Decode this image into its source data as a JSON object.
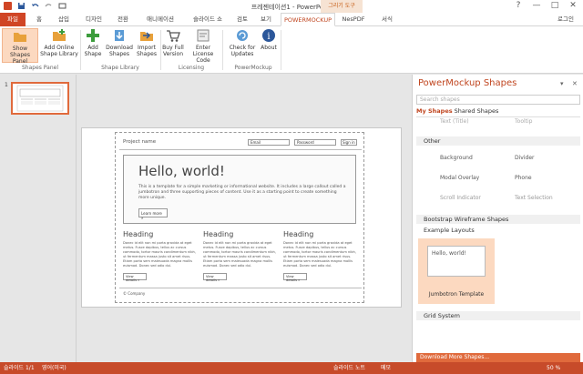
{
  "window": {
    "title": "프레젠테이션1 - PowerPoint",
    "context_tab_group": "그리기 도구",
    "minimize": "—",
    "maximize": "□",
    "close": "✕",
    "help": "?"
  },
  "qat": [
    "save",
    "undo",
    "redo",
    "start"
  ],
  "tabs": [
    "파일",
    "홈",
    "삽입",
    "디자인",
    "전환",
    "애니메이션",
    "슬라이드 쇼",
    "검토",
    "보기",
    "POWERMOCKUP",
    "NesPDF",
    "서식"
  ],
  "active_tab": "POWERMOCKUP",
  "user": "로그인",
  "ribbon": {
    "groups": [
      {
        "label": "Shapes Panel",
        "buttons": [
          {
            "label": "Show Shapes Panel"
          },
          {
            "label": "Add Online Shape Library"
          }
        ]
      },
      {
        "label": "Shape Library",
        "buttons": [
          {
            "label": "Add Shape"
          },
          {
            "label": "Download Shapes"
          },
          {
            "label": "Import Shapes"
          }
        ]
      },
      {
        "label": "Licensing",
        "buttons": [
          {
            "label": "Buy Full Version"
          },
          {
            "label": "Enter License Code"
          }
        ]
      },
      {
        "label": "PowerMockup",
        "buttons": [
          {
            "label": "Check for Updates"
          },
          {
            "label": "About"
          }
        ]
      }
    ]
  },
  "thumbs": {
    "num": "1"
  },
  "slide": {
    "project_name": "Project name",
    "email": "Email",
    "password": "Password",
    "signin": "Sign in",
    "hero_title": "Hello, world!",
    "hero_text": "This is a template for a simple marketing or informational website. It includes a large callout called a jumbotron and three supporting pieces of content. Use it as a starting point to create something more unique.",
    "learn_more": "Learn more »",
    "heading": "Heading",
    "body": "Donec id elit non mi porta gravida at eget metus. Fusce dapibus, tellus ac cursus commodo, tortor mauris condimentum nibh, ut fermentum massa justo sit amet risus. Etiam porta sem malesuada magna mollis euismod. Donec sed odio dui.",
    "view_details": "View details »",
    "footer": "© Company"
  },
  "pane": {
    "title": "PowerMockup Shapes",
    "search_placeholder": "Search shapes",
    "my_shapes": "My Shapes",
    "shared_shapes": "Shared Shapes",
    "top_items": [
      "Text (Title)",
      "Tooltip"
    ],
    "other_section": "Other",
    "other_items": [
      "Background",
      "Divider",
      "Modal Overlay",
      "Phone",
      "Scroll Indicator",
      "Text Selection"
    ],
    "bootstrap_section": "Bootstrap Wireframe Shapes",
    "example_layouts": "Example Layouts",
    "jumbotron": "Jumbotron Template",
    "jumbotron_mini": "Hello, world!",
    "grid_section": "Grid System",
    "download_more": "Download More Shapes..."
  },
  "status": {
    "slide": "슬라이드 1/1",
    "lang": "영어(미국)",
    "notes": "슬라이드 노트",
    "comments": "메모",
    "zoom": "50 %"
  },
  "colors": {
    "accent": "#c0451f",
    "status_bar": "#c74b2a",
    "selected": "#fcd9c0"
  }
}
